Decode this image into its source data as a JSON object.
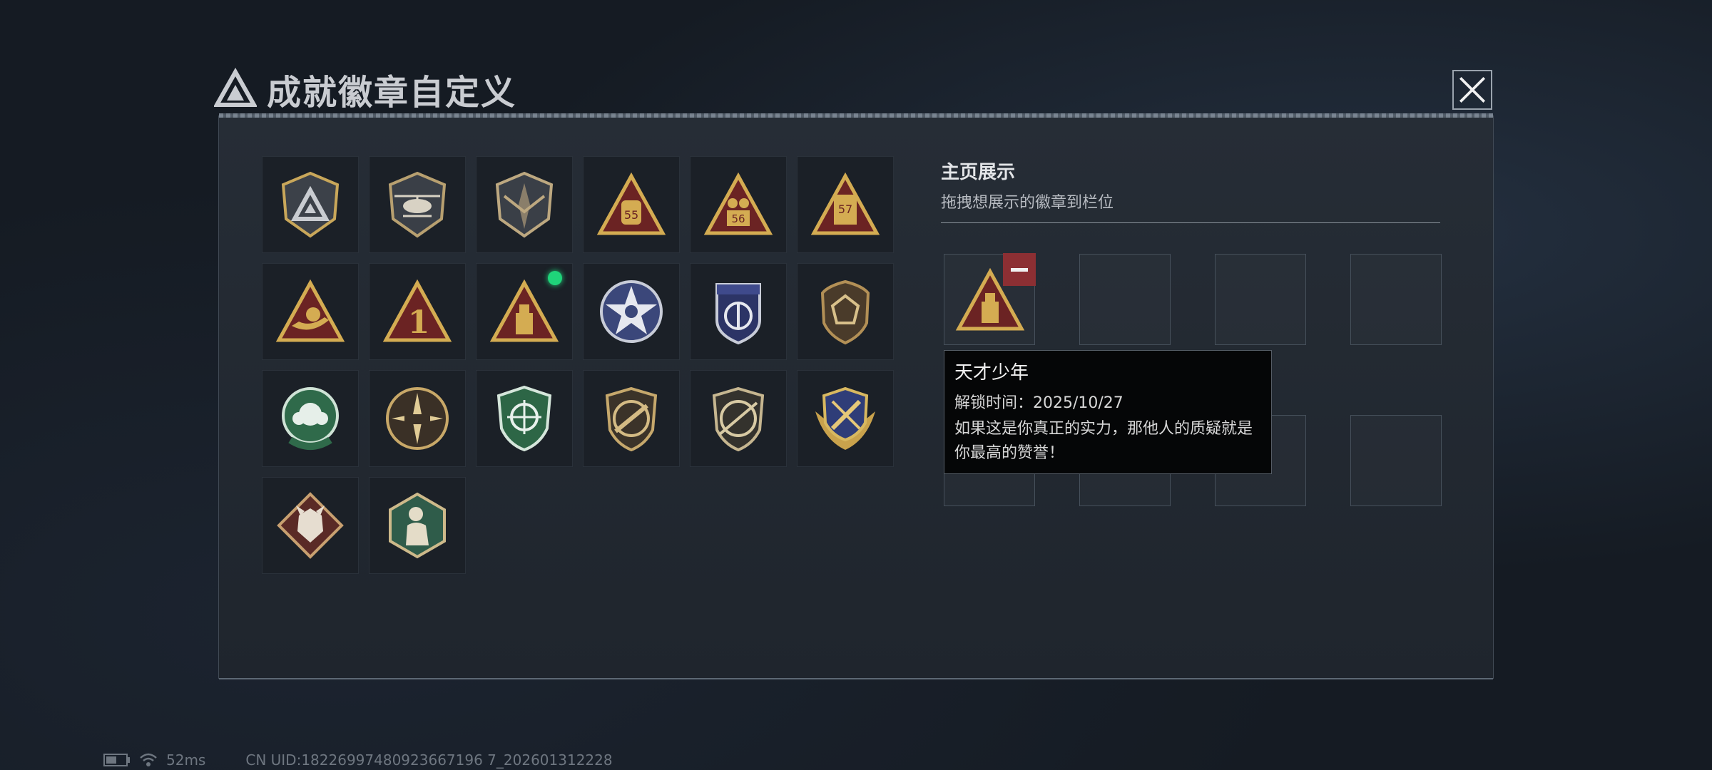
{
  "header": {
    "title": "成就徽章自定义",
    "logo_icon": "triangle-logo-icon",
    "close_icon": "close-icon"
  },
  "badges": [
    {
      "icon": "shield-triangle-badge-icon"
    },
    {
      "icon": "helicopter-shield-badge-icon"
    },
    {
      "icon": "dagger-shield-badge-icon"
    },
    {
      "icon": "triangle-55-badge-icon",
      "label": "55"
    },
    {
      "icon": "triangle-56-badge-icon",
      "label": "56"
    },
    {
      "icon": "triangle-57-badge-icon",
      "label": "57"
    },
    {
      "icon": "triangle-hand-badge-icon"
    },
    {
      "icon": "triangle-number-one-badge-icon",
      "label": "1"
    },
    {
      "icon": "triangle-usb-badge-icon",
      "is_new": true
    },
    {
      "icon": "star-round-badge-icon"
    },
    {
      "icon": "navy-shield-badge-icon"
    },
    {
      "icon": "bronze-shield-badge-icon"
    },
    {
      "icon": "green-round-badge-icon"
    },
    {
      "icon": "tank-round-badge-icon"
    },
    {
      "icon": "green-crosshair-shield-badge-icon"
    },
    {
      "icon": "rifle-shield-badge-icon"
    },
    {
      "icon": "sniper-shield-badge-icon"
    },
    {
      "icon": "gold-winged-shield-badge-icon"
    },
    {
      "icon": "wolf-diamond-badge-icon"
    },
    {
      "icon": "hexagon-soldier-badge-icon"
    }
  ],
  "showcase": {
    "title": "主页展示",
    "subtitle": "拖拽想展示的徽章到栏位",
    "slots": [
      {
        "filled": true,
        "icon": "triangle-usb-badge-icon",
        "remove_icon": "minus-icon"
      },
      {
        "filled": false
      },
      {
        "filled": false
      },
      {
        "filled": false
      },
      {
        "filled": false
      },
      {
        "filled": false
      },
      {
        "filled": false
      },
      {
        "filled": false
      }
    ]
  },
  "tooltip": {
    "title": "天才少年",
    "unlock_time": "解锁时间：2025/10/27",
    "description": "如果这是你真正的实力，那他人的质疑就是你最高的赞誉！"
  },
  "status_bar": {
    "battery_icon": "battery-icon",
    "wifi_icon": "wifi-icon",
    "latency": "52ms",
    "uid": "CN UID:18226997480923667196 7_202601312228"
  },
  "colors": {
    "accent_green": "#1fd47a",
    "remove_red": "#8c2f33",
    "gold": "#d4ac52",
    "maroon": "#6b2323"
  }
}
